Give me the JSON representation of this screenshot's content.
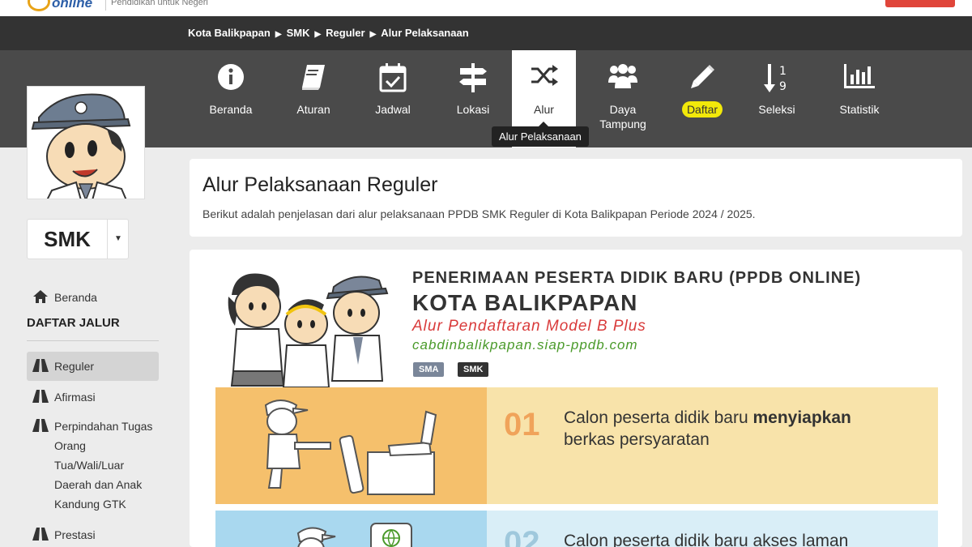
{
  "header": {
    "logo_text": "online",
    "tagline": "Pendidikan untuk Negeri"
  },
  "breadcrumb": [
    "Kota Balikpapan",
    "SMK",
    "Reguler",
    "Alur Pelaksanaan"
  ],
  "nav": {
    "items": [
      {
        "label": "Beranda",
        "icon": "info-icon"
      },
      {
        "label": "Aturan",
        "icon": "book-icon"
      },
      {
        "label": "Jadwal",
        "icon": "calendar-check-icon"
      },
      {
        "label": "Lokasi",
        "icon": "signpost-icon"
      },
      {
        "label": "Alur",
        "icon": "shuffle-icon"
      },
      {
        "label": "Daya Tampung",
        "icon": "users-icon"
      },
      {
        "label": "Daftar",
        "icon": "pencil-icon"
      },
      {
        "label": "Seleksi",
        "icon": "sort-numeric-icon"
      },
      {
        "label": "Statistik",
        "icon": "bar-chart-icon"
      }
    ],
    "active": "Alur",
    "tooltip": "Alur Pelaksanaan"
  },
  "sidebar": {
    "level_select": "SMK",
    "home_link": "Beranda",
    "section_title": "DAFTAR JALUR",
    "paths": [
      {
        "label": "Reguler",
        "active": true
      },
      {
        "label": "Afirmasi"
      },
      {
        "label": "Perpindahan Tugas",
        "lines": [
          "Perpindahan Tugas",
          "Orang",
          "Tua/Wali/Luar",
          "Daerah dan Anak",
          "Kandung GTK"
        ]
      },
      {
        "label": "Prestasi"
      }
    ]
  },
  "main": {
    "title": "Alur Pelaksanaan Reguler",
    "description": "Berikut adalah penjelasan dari alur pelaksanaan PPDB SMK Reguler di Kota Balikpapan Periode 2024 / 2025."
  },
  "infographic": {
    "heading1": "PENERIMAAN PESERTA DIDIK BARU (PPDB ONLINE)",
    "heading2": "KOTA BALIKPAPAN",
    "subtitle": "Alur Pendaftaran Model B Plus",
    "website": "cabdinbalikpapan.siap-ppdb.com",
    "badges": [
      "SMA",
      "SMK"
    ],
    "steps": [
      {
        "number": "01",
        "text_pre": "Calon peserta didik baru ",
        "text_bold": "menyiapkan",
        "text_post": "berkas persyaratan"
      },
      {
        "number": "02",
        "text_pre": "Calon peserta didik baru akses laman",
        "text_bold": "",
        "text_post": ""
      }
    ]
  },
  "colors": {
    "nav_bg": "#4a4a4a",
    "breadcrumb_bg": "#333333",
    "daftar_highlight": "#f2e90a",
    "step1_bg": "#f8e3aa",
    "step1_illus": "#f5c06c",
    "step2_bg": "#d9eef7",
    "accent_red": "#d93b3b",
    "accent_green": "#4a9a2a"
  }
}
